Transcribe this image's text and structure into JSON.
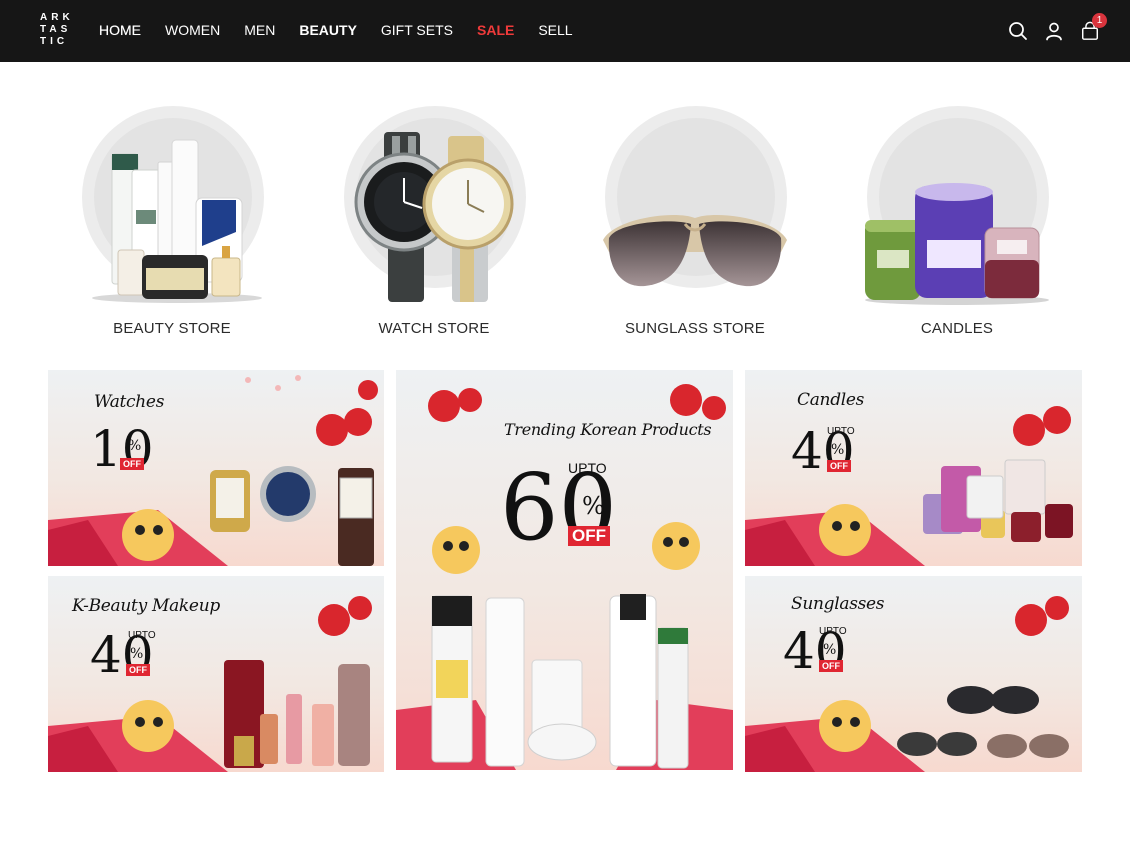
{
  "header": {
    "logo_lines": [
      "ARK",
      "TAS",
      "TIC"
    ],
    "nav": [
      {
        "label": "HOME",
        "style": "active"
      },
      {
        "label": "WOMEN",
        "style": "normal"
      },
      {
        "label": "MEN",
        "style": "normal"
      },
      {
        "label": "BEAUTY",
        "style": "bold"
      },
      {
        "label": "GIFT SETS",
        "style": "normal"
      },
      {
        "label": "SALE",
        "style": "sale"
      },
      {
        "label": "SELL",
        "style": "normal"
      }
    ],
    "cart_count": "1",
    "icons": [
      "search-icon",
      "user-icon",
      "cart-icon"
    ]
  },
  "categories": [
    {
      "label": "BEAUTY STORE",
      "icon": "skincare-products"
    },
    {
      "label": "WATCH STORE",
      "icon": "watches"
    },
    {
      "label": "SUNGLASS STORE",
      "icon": "sunglasses"
    },
    {
      "label": "CANDLES",
      "icon": "candles"
    }
  ],
  "banners": {
    "watches": {
      "title": "Watches",
      "number": "10",
      "percent": "%",
      "off": "OFF"
    },
    "kbeauty": {
      "title": "K-Beauty Makeup",
      "upto": "UPTO",
      "number": "40",
      "percent": "%",
      "off": "OFF"
    },
    "trending": {
      "title": "Trending Korean Products",
      "upto": "UPTO",
      "number": "60",
      "percent": "%",
      "off": "OFF"
    },
    "candles": {
      "title": "Candles",
      "upto": "UPTO",
      "number": "40",
      "percent": "%",
      "off": "OFF"
    },
    "sunglasses": {
      "title": "Sunglasses",
      "upto": "UPTO",
      "number": "40",
      "percent": "%",
      "off": "OFF"
    }
  },
  "colors": {
    "header_bg": "#161616",
    "sale_red": "#ef3a3a",
    "badge_red": "#d9343d",
    "banner_red": "#e02632"
  }
}
